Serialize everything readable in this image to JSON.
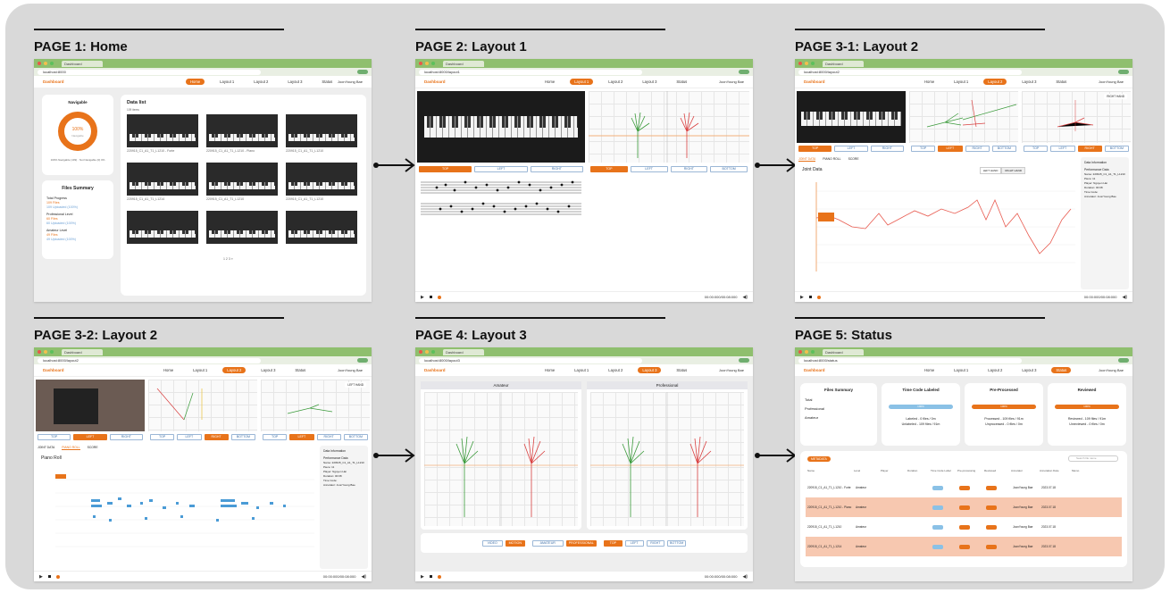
{
  "panels": [
    {
      "title": "PAGE 1: Home"
    },
    {
      "title": "PAGE 2: Layout 1"
    },
    {
      "title": "PAGE 3-1: Layout 2"
    },
    {
      "title": "PAGE 3-2: Layout 2"
    },
    {
      "title": "PAGE 4: Layout 3"
    },
    {
      "title": "PAGE 5: Status"
    }
  ],
  "browser": {
    "tab": "Dashboard",
    "url_home": "localhost:8000",
    "url_layout1": "localhost:8000/layout1",
    "url_layout2": "localhost:8000/layout2",
    "url_layout3": "localhost:8000/layout3",
    "url_status": "localhost:8000/status"
  },
  "nav": {
    "logo": "Dashboard",
    "items": [
      "Home",
      "Layout 1",
      "Layout 2",
      "Layout 3",
      "Status"
    ],
    "user": "JoonYoung Bae"
  },
  "footer": {
    "time": "00:00:000/00:08:000"
  },
  "view_buttons": {
    "top": "TOP",
    "left": "LEFT",
    "right": "RIGHT",
    "bottom": "BOTTOM"
  },
  "home": {
    "card_title": "Navigable",
    "percent": "100%",
    "percent_sub": "Navigable",
    "nav_line": "100% Navigable (109) · Not Navigable (0) 0%",
    "summary_title": "Files Summary",
    "total_label": "Total Progress",
    "total_value": "109 Files",
    "total_sub": "109 Uploaded (100%)",
    "pro_label": "Professional Level",
    "pro_value": "60 Files",
    "pro_sub": "60 Uploaded (100%)",
    "ama_label": "Amateur Level",
    "ama_value": "49 Files",
    "ama_sub": "49 Uploaded (100%)",
    "data_list": "Data list",
    "items_count": "109 items",
    "items": [
      "220915_C1_A1_T1_L1210 - Forte",
      "220915_C1_A1_T1_L1210 - Piano",
      "220915_C1_A1_T1_L1210",
      "220915_C1_A1_T1_L1214",
      "220915_C1_A1_T1_L1210",
      "220915_C1_A1_T1_L1210"
    ],
    "pagination": "1 2 3 »"
  },
  "layout2": {
    "tabs": [
      "JOINT DATA",
      "PIANO ROLL",
      "SCORE"
    ],
    "joint_title": "Joint Data",
    "hand_left": "LEFT HAND",
    "hand_right": "RIGHT HAND",
    "info_title": "Data Information",
    "perf_title": "Performance Data",
    "piano_roll": "Piano Roll",
    "right_hand_badge": "RIGHT HAND",
    "left_hand_badge": "LEFT HAND",
    "info_lines": [
      "Name: 220915_C1_A1_T1_L1210",
      "Piece: 11",
      "Player: Nguyen Hai",
      "Duration: 00:08",
      "Time Code:",
      "Annotator: JoonYoung Bae"
    ]
  },
  "layout3": {
    "amateur": "Amateur",
    "professional": "Professional",
    "controls": [
      "VIDEO",
      "MOTION",
      "AMATEUR",
      "PROFESSIONAL",
      "TOP",
      "LEFT",
      "RIGHT",
      "BOTTOM"
    ]
  },
  "status": {
    "files_summary": "Files Summary",
    "timecode": "Time Code Labeled",
    "preprocessed": "Pre-Processed",
    "reviewed": "Reviewed",
    "rows": [
      "Total",
      "Professional",
      "Amateur"
    ],
    "tc_lines": [
      "Labeled - 0 files / 0m",
      "Unlabeled - 109 files / 91m"
    ],
    "pp_lines": [
      "Processed - 109 files / 91m",
      "Unprocessed - 0 files / 0m"
    ],
    "rv_lines": [
      "Reviewed - 109 files / 91m",
      "Unreviewed - 0 files / 0m"
    ],
    "tc_bar": "100%",
    "pp_bar": "100%",
    "rv_bar": "100%",
    "metadata": "METADATA",
    "search": "Search file name",
    "columns": [
      "Name",
      "Level",
      "Player",
      "Duration",
      "Time Code Label",
      "Pre-processing",
      "Reviewed",
      "Annotator",
      "Annotation Date",
      "Memo"
    ],
    "table_rows": [
      {
        "name": "220915_C1_A1_T1_L1210 - Forte",
        "level": "Amateur",
        "date": "2023.07.18"
      },
      {
        "name": "220915_C1_A1_T1_L1210 - Piano",
        "level": "Amateur",
        "date": "2023.07.18"
      },
      {
        "name": "220915_C1_A1_T1_L1210",
        "level": "Amateur",
        "date": "2023.07.18"
      },
      {
        "name": "220915_C1_A1_T1_L1214",
        "level": "Amateur",
        "date": "2023.07.18"
      }
    ]
  },
  "colors": {
    "accent": "#e8731a",
    "board": "#d9d9d9",
    "blue": "#3d6fa8",
    "green": "#3a9a3a",
    "red": "#d94040"
  }
}
